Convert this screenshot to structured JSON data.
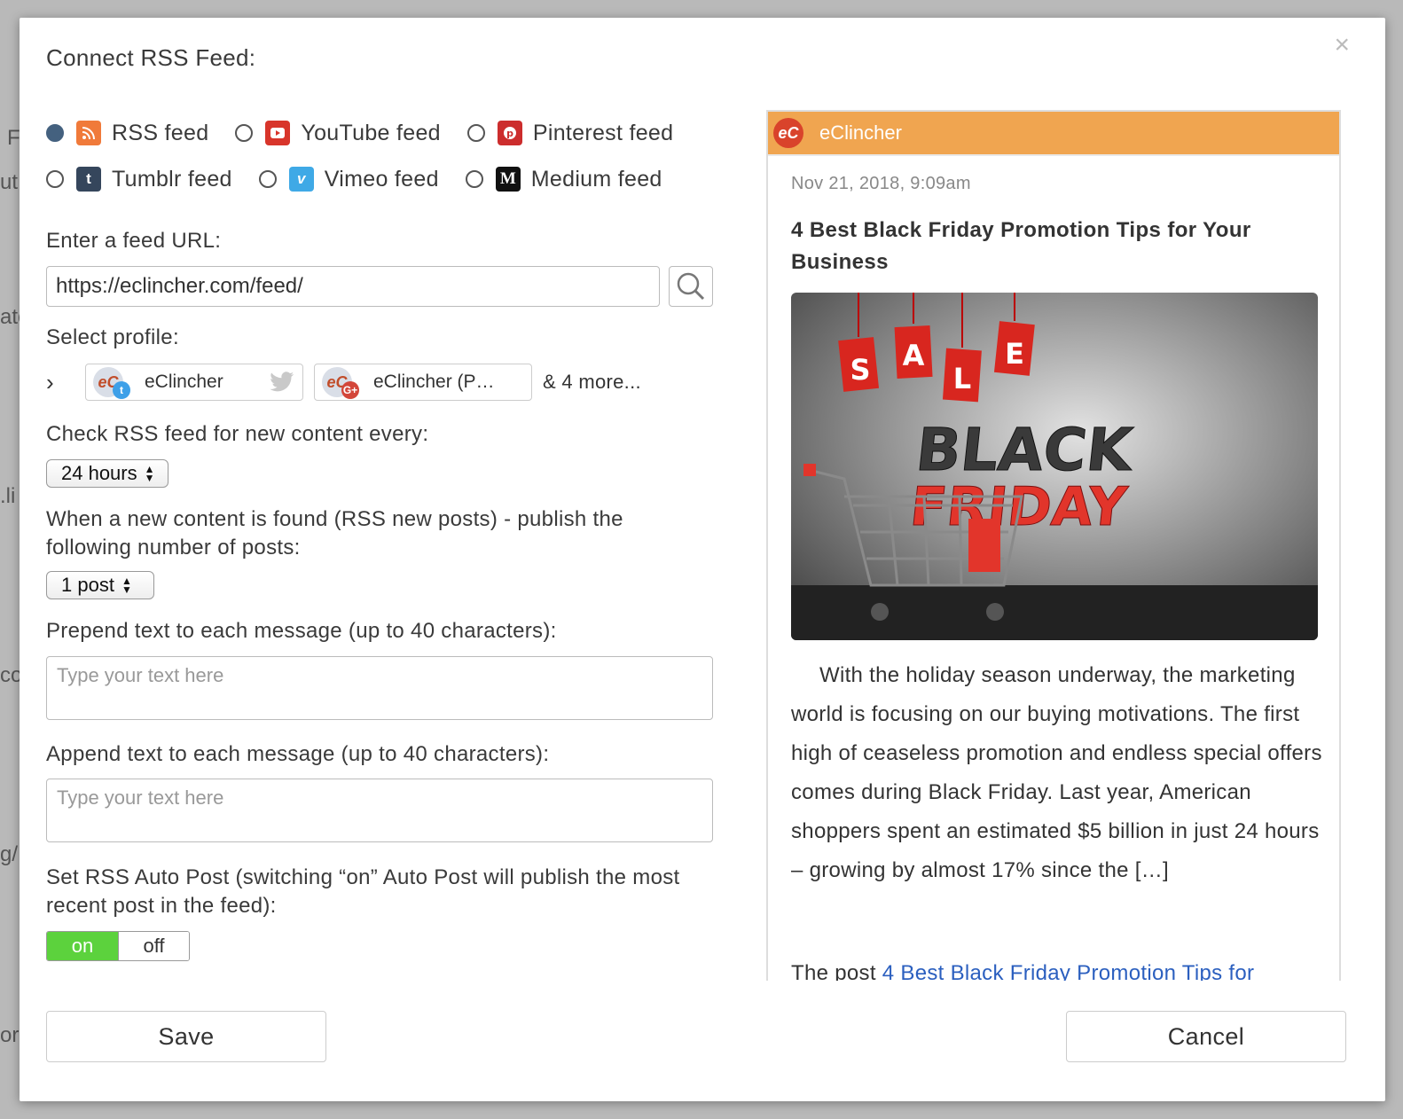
{
  "dialog": {
    "title": "Connect RSS Feed:",
    "close_label": "×"
  },
  "feed_types": [
    {
      "label": "RSS feed",
      "selected": true,
      "icon": "rss-icon",
      "color": "#f07a3a"
    },
    {
      "label": "YouTube feed",
      "selected": false,
      "icon": "youtube-icon",
      "color": "#d8352b"
    },
    {
      "label": "Pinterest feed",
      "selected": false,
      "icon": "pinterest-icon",
      "color": "#cc2d2d"
    },
    {
      "label": "Tumblr feed",
      "selected": false,
      "icon": "tumblr-icon",
      "color": "#35465c"
    },
    {
      "label": "Vimeo feed",
      "selected": false,
      "icon": "vimeo-icon",
      "color": "#3fa9e6"
    },
    {
      "label": "Medium feed",
      "selected": false,
      "icon": "medium-icon",
      "color": "#111111"
    }
  ],
  "url": {
    "label": "Enter a feed URL:",
    "value": "https://eclincher.com/feed/"
  },
  "profile": {
    "label": "Select profile:",
    "chips": [
      {
        "name": "eClincher",
        "network": "twitter"
      },
      {
        "name": "eClincher (P…",
        "network": "google-plus"
      }
    ],
    "more": "& 4 more..."
  },
  "frequency": {
    "label": "Check RSS feed for new content every:",
    "value": "24 hours"
  },
  "posts": {
    "label": "When a new content is found (RSS new posts) - publish the following number of posts:",
    "value": "1 post"
  },
  "prepend": {
    "label": "Prepend text to each message (up to 40 characters):",
    "placeholder": "Type your text here"
  },
  "append": {
    "label": "Append text to each message (up to 40 characters):",
    "placeholder": "Type your text here"
  },
  "autopost": {
    "label": "Set RSS Auto Post (switching “on” Auto Post will publish the most recent post in the feed):",
    "on": "on",
    "off": "off",
    "state": "on"
  },
  "preview": {
    "source": "eClincher",
    "date": "Nov 21, 2018, 9:09am",
    "title": "4 Best Black Friday Promotion Tips for Your Business",
    "image_text": {
      "sale": [
        "S",
        "A",
        "L",
        "E"
      ],
      "black": "BLACK",
      "friday": "FRIDAY"
    },
    "body": "With the holiday season underway, the marketing world is focusing on our buying motivations. The first high of ceaseless promotion and endless special offers comes during Black Friday. Last year, American shoppers spent an estimated $5 billion in just 24 hours – growing by almost 17% since the […]",
    "post_prefix": "The post ",
    "post_link": "4 Best Black Friday Promotion Tips for"
  },
  "buttons": {
    "save": "Save",
    "cancel": "Cancel"
  },
  "colors": {
    "accent": "#f0a550",
    "toggle_on": "#5cd23d",
    "radio_selected": "#44617f"
  }
}
